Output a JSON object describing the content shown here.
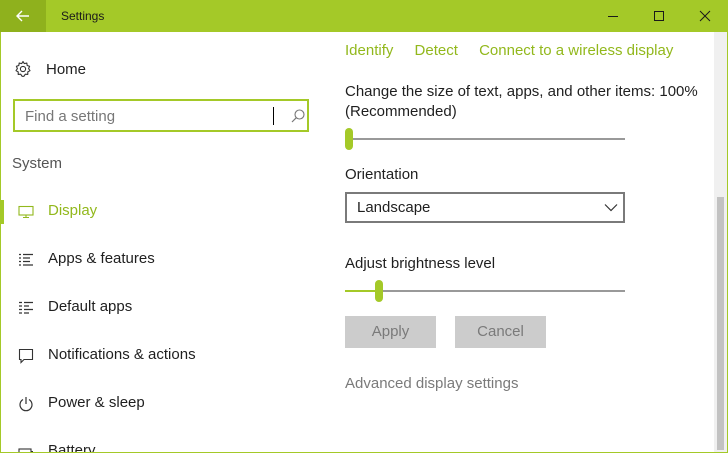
{
  "window": {
    "title": "Settings",
    "accent_color": "#a4c928"
  },
  "sidebar": {
    "home_label": "Home",
    "search_placeholder": "Find a setting",
    "section_label": "System",
    "items": [
      {
        "label": "Display",
        "icon": "monitor-icon",
        "active": true
      },
      {
        "label": "Apps & features",
        "icon": "list-icon",
        "active": false
      },
      {
        "label": "Default apps",
        "icon": "default-apps-icon",
        "active": false
      },
      {
        "label": "Notifications & actions",
        "icon": "notifications-icon",
        "active": false
      },
      {
        "label": "Power & sleep",
        "icon": "power-icon",
        "active": false
      },
      {
        "label": "Battery",
        "icon": "battery-icon",
        "active": false
      }
    ]
  },
  "display": {
    "links": [
      "Identify",
      "Detect",
      "Connect to a wireless display"
    ],
    "scale_label": "Change the size of text, apps, and other items: 100% (Recommended)",
    "scale_slider_fraction": 0.0,
    "orientation_label": "Orientation",
    "orientation_value": "Landscape",
    "brightness_label": "Adjust brightness level",
    "brightness_slider_fraction": 0.11,
    "apply_label": "Apply",
    "cancel_label": "Cancel",
    "advanced_link": "Advanced display settings"
  }
}
